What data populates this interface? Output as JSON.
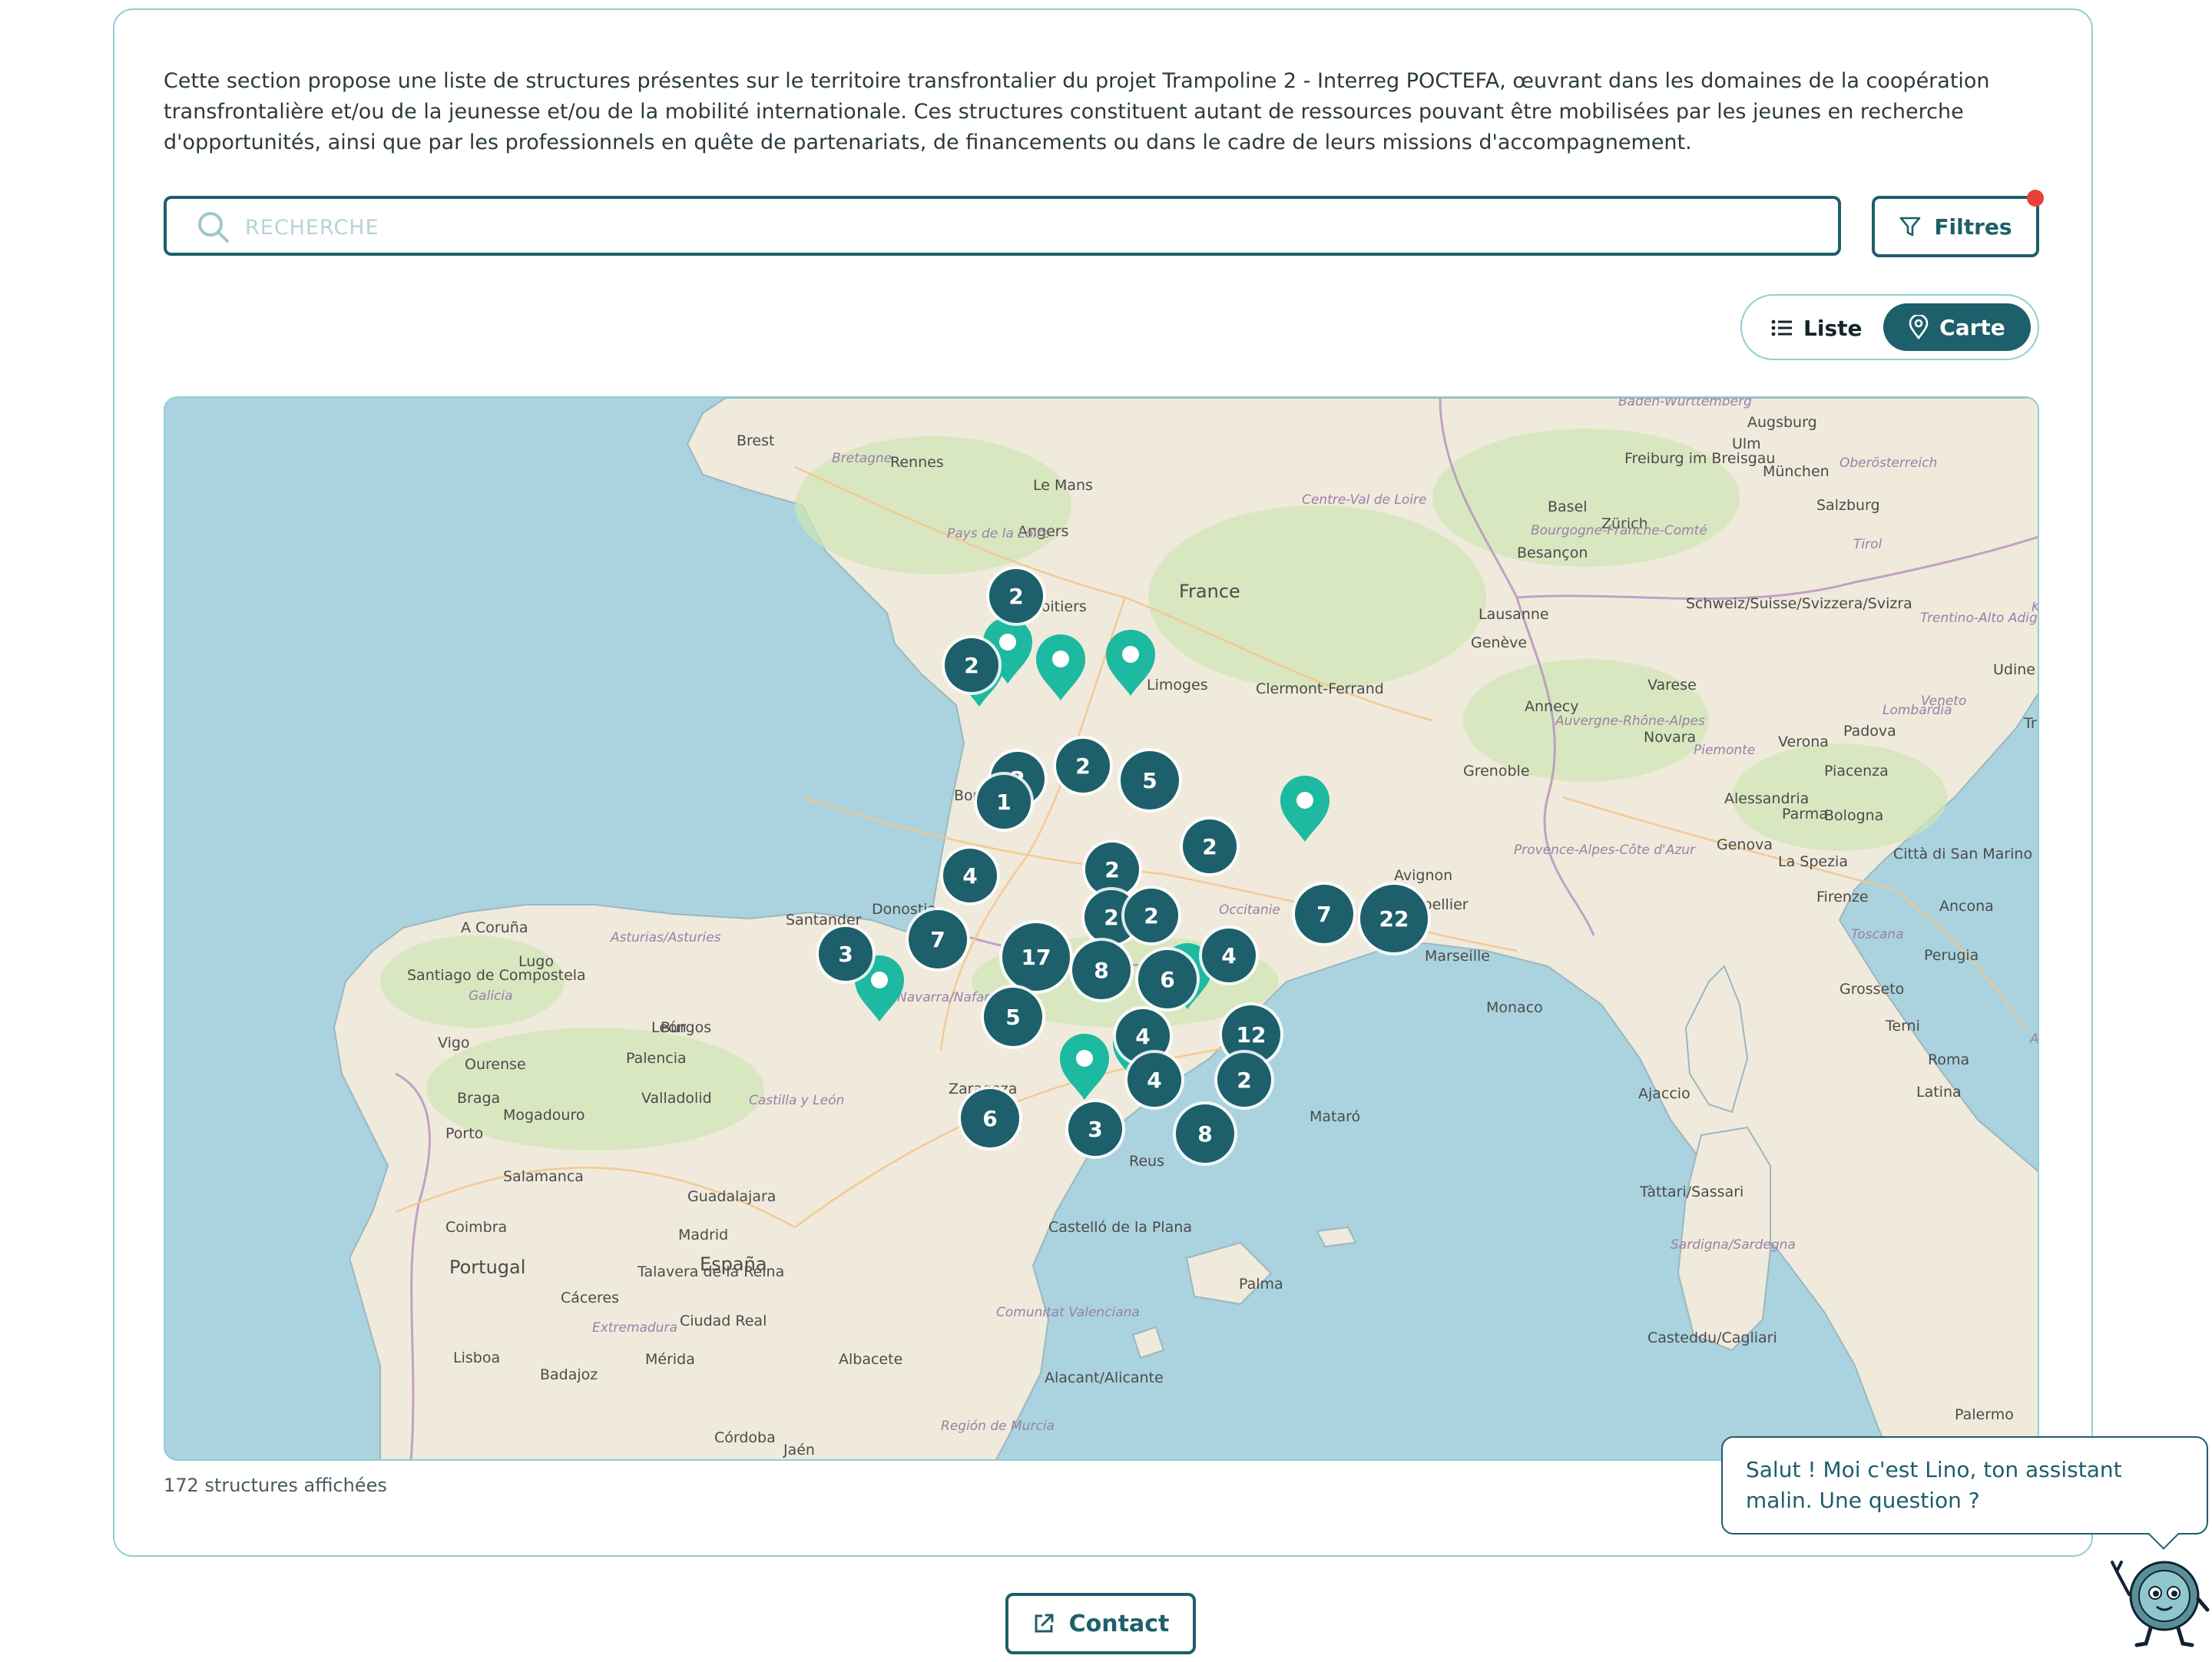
{
  "intro_text": "Cette section propose une liste de structures présentes sur le territoire transfrontalier du projet Trampoline 2 - Interreg POCTEFA, œuvrant dans les domaines de la coopération transfrontalière et/ou de la jeunesse et/ou de la mobilité internationale. Ces structures constituent autant de ressources pouvant être mobilisées par les jeunes en recherche d'opportunités, ainsi que par les professionnels en quête de partenariats, de financements ou dans le cadre de leurs missions d'accompagnement.",
  "search": {
    "placeholder": "RECHERCHE",
    "icon": "search-icon"
  },
  "filters_button": {
    "label": "Filtres",
    "icon": "filter-icon",
    "badge_color": "#e8403a"
  },
  "view_toggle": {
    "liste_label": "Liste",
    "carte_label": "Carte",
    "active": "Carte"
  },
  "map": {
    "cluster_counts": [
      "2",
      "2",
      "2",
      "2",
      "5",
      "2",
      "2",
      "4",
      "2",
      "2",
      "22",
      "7",
      "7",
      "3",
      "17",
      "8",
      "6",
      "4",
      "5",
      "12",
      "4",
      "4",
      "2",
      "6",
      "3",
      "8",
      "1"
    ],
    "place_labels": [
      "Brest",
      "Rennes",
      "Le Mans",
      "Angers",
      "Poitiers",
      "France",
      "Limoges",
      "Clermont-Ferrand",
      "Bordeaux",
      "Avignon",
      "Montpellier",
      "Marseille",
      "Grenoble",
      "Annecy",
      "Lausanne",
      "Genève",
      "Zürich",
      "Basel",
      "Freiburg im Breisgau",
      "Augsburg",
      "München",
      "Salzburg",
      "Ulm",
      "Besançon",
      "Schweiz/Suisse/Svizzera/Svizra",
      "Novara",
      "Varese",
      "Verona",
      "Padova",
      "Trieste",
      "Udine",
      "Piacenza",
      "Alessandria",
      "Parma",
      "Bologna",
      "Genova",
      "La Spezia",
      "Firenze",
      "Città di San Marino",
      "Ancona",
      "Perugia",
      "Grosseto",
      "Terni",
      "Roma",
      "Latina",
      "Monaco",
      "Ajaccio",
      "Tàttari/Sassari",
      "Casteddu/Cagliari",
      "Palermo",
      "Palma",
      "Santander",
      "A Coruña",
      "Santiago de Compostela",
      "Lugo",
      "Vigo",
      "Ourense",
      "León",
      "Burgos",
      "Palencia",
      "Valladolid",
      "Braga",
      "Porto",
      "Mogadouro",
      "Salamanca",
      "Zaragoza",
      "Guadalajara",
      "Madrid",
      "España",
      "Coimbra",
      "Portugal",
      "Talavera de la Reina",
      "Cáceres",
      "Ciudad Real",
      "Mérida",
      "Lisboa",
      "Badajoz",
      "Albacete",
      "Alacant/Alicante",
      "Córdoba",
      "Jaén",
      "Castelló de la Plana",
      "Reus",
      "Mataró",
      "Donostia"
    ],
    "region_labels": [
      "Bretagne",
      "Pays de la Loire",
      "Centre-Val de Loire",
      "Bourgogne-Franche-Comté",
      "Auvergne-Rhône-Alpes",
      "Provence-Alpes-Côte d'Azur",
      "Occitanie",
      "Baden-Württemberg",
      "Tirol",
      "Trentino-Alto Adige/Südtirol",
      "Lombardia",
      "Veneto",
      "Piemonte",
      "Toscana",
      "Abruzzo",
      "Sardigna/Sardegna",
      "Asturias/Asturies",
      "Galicia",
      "Castilla y León",
      "Navarra/Nafarroa",
      "Extremadura",
      "Comunitat Valenciana",
      "Región de Murcia",
      "Oberösterreich",
      "Kärnten"
    ]
  },
  "structures_count_text": "172 structures affichées",
  "assistant": {
    "message": "Salut ! Moi c'est Lino, ton assistant malin. Une question ?"
  },
  "contact_button": {
    "label": "Contact",
    "icon": "external-link-icon"
  },
  "colors": {
    "primary": "#1d5f6b",
    "marker": "#1db9a0",
    "border": "#8fcfd2"
  }
}
